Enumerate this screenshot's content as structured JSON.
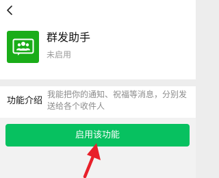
{
  "app": {
    "title": "群发助手",
    "status": "未启用",
    "icon": "group-people-icon",
    "icon_color": "#1aad19"
  },
  "nav": {
    "back_icon": "chevron-left-icon"
  },
  "intro": {
    "label": "功能介绍",
    "text": "我能把你的通知、祝福等消息，分别发送给各个收件人"
  },
  "action": {
    "enable_label": "启用该功能",
    "button_color": "#07c160"
  },
  "annotation": {
    "arrow_color": "#e8202a"
  }
}
